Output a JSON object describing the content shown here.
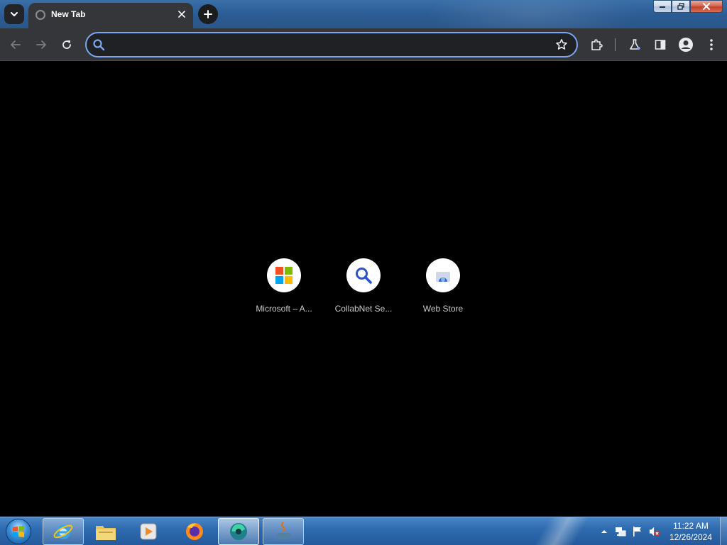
{
  "browser": {
    "tab": {
      "title": "New Tab",
      "favicon": "globe-icon"
    },
    "omnibox": {
      "value": "",
      "placeholder": ""
    },
    "colors": {
      "omnibox_focus": "#7ca6f0",
      "toolbar": "#35363a",
      "content_bg": "#000000"
    }
  },
  "shortcuts": [
    {
      "label": "Microsoft – A...",
      "icon": "microsoft-logo-icon"
    },
    {
      "label": "CollabNet Se...",
      "icon": "search-magnifier-icon"
    },
    {
      "label": "Web Store",
      "icon": "web-store-icon"
    }
  ],
  "taskbar": {
    "apps": [
      "internet-explorer-icon",
      "file-explorer-icon",
      "media-player-icon",
      "firefox-icon",
      "browser-app-icon",
      "java-icon"
    ],
    "clock": {
      "time": "11:22 AM",
      "date": "12/26/2024"
    }
  }
}
